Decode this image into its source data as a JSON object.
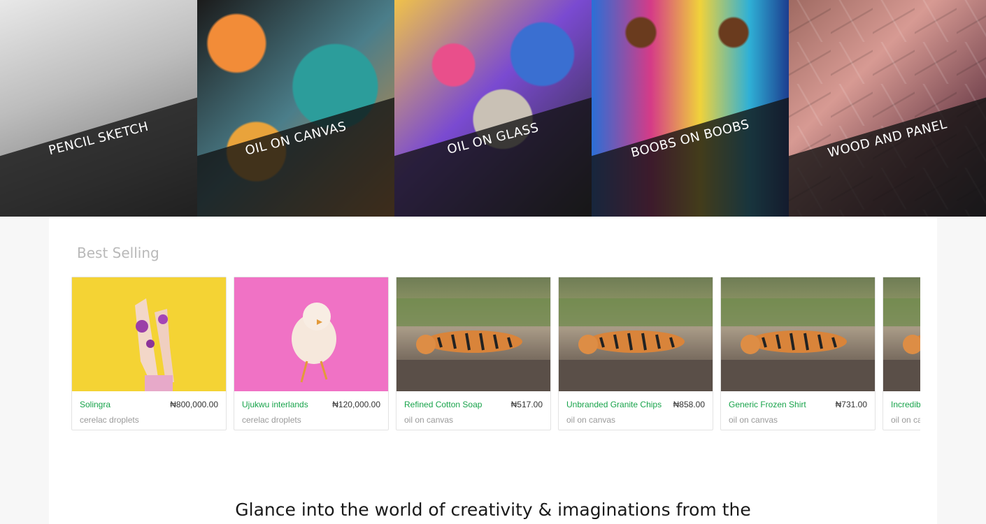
{
  "categories": [
    {
      "label": "PENCIL SKETCH"
    },
    {
      "label": "OIL ON CANVAS"
    },
    {
      "label": "OIL ON GLASS"
    },
    {
      "label": "BOOBS ON BOOBS"
    },
    {
      "label": "WOOD AND PANEL"
    }
  ],
  "best_selling": {
    "title": "Best Selling",
    "products": [
      {
        "name": "Solingra",
        "price": "₦800,000.00",
        "category": "cerelac droplets"
      },
      {
        "name": "Ujukwu interlands",
        "price": "₦120,000.00",
        "category": "cerelac droplets"
      },
      {
        "name": "Refined Cotton Soap",
        "price": "₦517.00",
        "category": "oil on canvas"
      },
      {
        "name": "Unbranded Granite Chips",
        "price": "₦858.00",
        "category": "oil on canvas"
      },
      {
        "name": "Generic Frozen Shirt",
        "price": "₦731.00",
        "category": "oil on canvas"
      },
      {
        "name": "Incredib",
        "price": "",
        "category": "oil on ca"
      }
    ]
  },
  "tagline": "Glance into the world of creativity & imaginations from the",
  "colors": {
    "product_name": "#17a34a",
    "section_title": "#b9b9b9"
  }
}
